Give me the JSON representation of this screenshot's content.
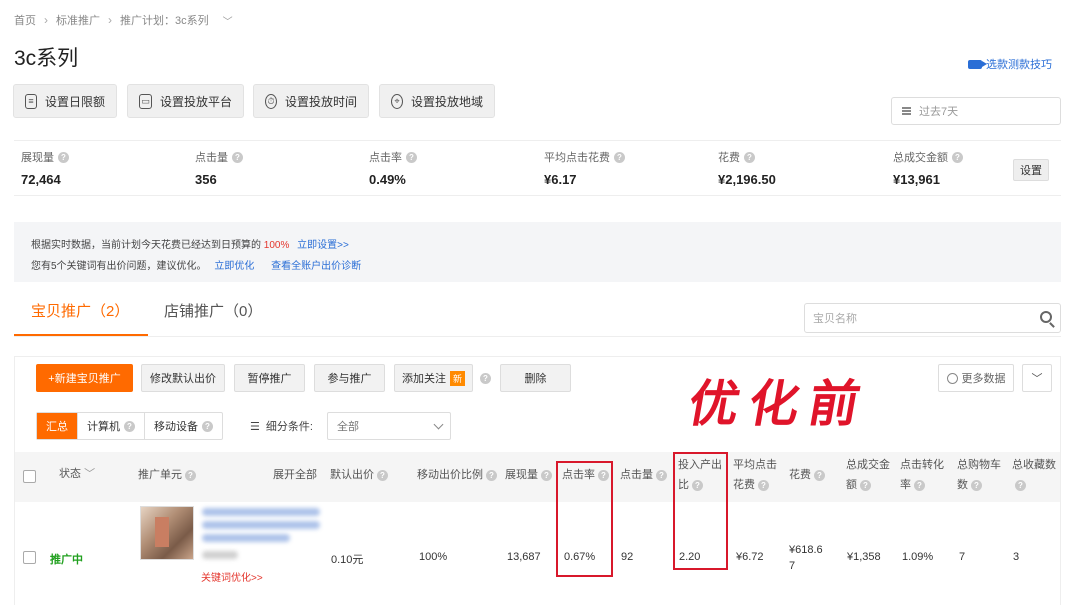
{
  "breadcrumb": {
    "home": "首页",
    "standard": "标准推广",
    "plan": "推广计划：3c系列"
  },
  "page": {
    "title": "3c系列",
    "tips_link": "选款测款技巧"
  },
  "toolbar": {
    "daily_limit": "设置日限额",
    "platform": "设置投放平台",
    "time": "设置投放时间",
    "region": "设置投放地域"
  },
  "date_range": "过去7天",
  "metrics": [
    {
      "label": "展现量",
      "value": "72,464"
    },
    {
      "label": "点击量",
      "value": "356"
    },
    {
      "label": "点击率",
      "value": "0.49%"
    },
    {
      "label": "平均点击花费",
      "value": "¥6.17"
    },
    {
      "label": "花费",
      "value": "¥2,196.50"
    },
    {
      "label": "总成交金额",
      "value": "¥13,961"
    }
  ],
  "metrics_setting": "设置",
  "notice": {
    "line1_prefix": "根据实时数据，当前计划今天花费已经达到日预算的",
    "line1_pct": "100%",
    "line1_link": "立即设置>>",
    "line2_text": "您有5个关键词有出价问题，建议优化。",
    "line2_link1": "立即优化",
    "line2_link2": "查看全账户出价诊断"
  },
  "tabs": [
    {
      "label": "宝贝推广（2）"
    },
    {
      "label": "店铺推广（0）"
    }
  ],
  "search_placeholder": "宝贝名称",
  "actions": {
    "new": "+新建宝贝推广",
    "modify_bid": "修改默认出价",
    "pause": "暂停推广",
    "join": "参与推广",
    "follow": "添加关注",
    "follow_badge": "新",
    "delete": "删除",
    "more_data": "更多数据"
  },
  "annotation": "优化前",
  "device_tabs": [
    "汇总",
    "计算机",
    "移动设备"
  ],
  "filter": {
    "label": "细分条件:",
    "value": "全部"
  },
  "table": {
    "headers": {
      "status": "状态",
      "unit": "推广单元",
      "expand_all": "展开全部",
      "default_bid": "默认出价",
      "mobile_ratio": "移动出价比例",
      "impressions": "展现量",
      "ctr": "点击率",
      "clicks": "点击量",
      "roi_1": "投入产出",
      "roi_2": "比",
      "cpc_1": "平均点击",
      "cpc_2": "花费",
      "cost": "花费",
      "gmv_1": "总成交金",
      "gmv_2": "额",
      "cvr_1": "点击转化",
      "cvr_2": "率",
      "cart_1": "总购物车",
      "cart_2": "数",
      "fav": "总收藏数"
    },
    "row": {
      "status": "推广中",
      "keyword_link": "关键词优化>>",
      "default_bid": "0.10元",
      "mobile_ratio": "100%",
      "impressions": "13,687",
      "ctr": "0.67%",
      "clicks": "92",
      "roi": "2.20",
      "cpc": "¥6.72",
      "cost_1": "¥618.6",
      "cost_2": "7",
      "gmv": "¥1,358",
      "cvr": "1.09%",
      "cart": "7",
      "fav": "3"
    }
  }
}
